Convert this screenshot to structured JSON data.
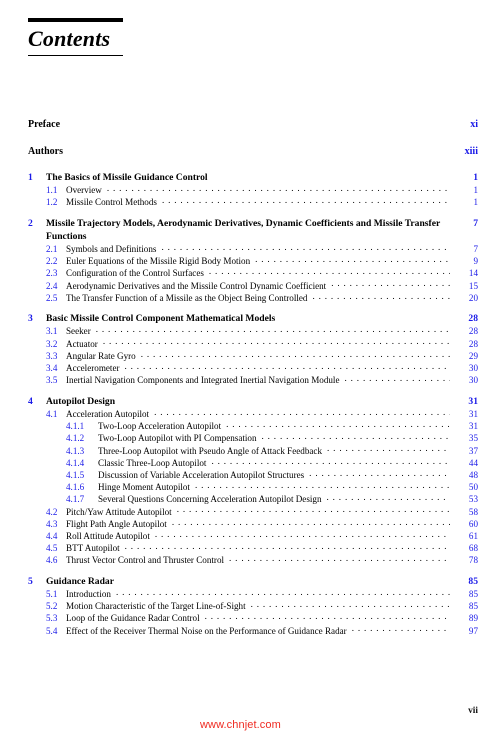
{
  "page": {
    "title": "Contents",
    "folio": "vii",
    "watermark": "www.chnjet.com",
    "accent_color": "#1a1ae8",
    "watermark_color": "#ef2b22"
  },
  "front_matter": [
    {
      "title": "Preface",
      "page": "xi"
    },
    {
      "title": "Authors",
      "page": "xiii"
    }
  ],
  "chapters": [
    {
      "num": "1",
      "title": "The Basics of Missile Guidance Control",
      "page": "1",
      "wrapped": false,
      "entries": [
        {
          "level": "section",
          "num": "1.1",
          "title": "Overview",
          "page": "1"
        },
        {
          "level": "section",
          "num": "1.2",
          "title": "Missile Control Methods",
          "page": "1"
        }
      ]
    },
    {
      "num": "2",
      "title": "Missile Trajectory Models, Aerodynamic Derivatives, Dynamic Coefficients and Missile Transfer Functions",
      "page": "7",
      "wrapped": true,
      "entries": [
        {
          "level": "section",
          "num": "2.1",
          "title": "Symbols and Definitions",
          "page": "7"
        },
        {
          "level": "section",
          "num": "2.2",
          "title": "Euler Equations of the Missile Rigid Body Motion",
          "page": "9"
        },
        {
          "level": "section",
          "num": "2.3",
          "title": "Configuration of the Control Surfaces",
          "page": "14"
        },
        {
          "level": "section",
          "num": "2.4",
          "title": "Aerodynamic Derivatives and the Missile Control Dynamic Coefficient",
          "page": "15"
        },
        {
          "level": "section",
          "num": "2.5",
          "title": "The Transfer Function of a Missile as the Object Being Controlled",
          "page": "20"
        }
      ]
    },
    {
      "num": "3",
      "title": "Basic Missile Control Component Mathematical Models",
      "page": "28",
      "wrapped": false,
      "entries": [
        {
          "level": "section",
          "num": "3.1",
          "title": "Seeker",
          "page": "28"
        },
        {
          "level": "section",
          "num": "3.2",
          "title": "Actuator",
          "page": "28"
        },
        {
          "level": "section",
          "num": "3.3",
          "title": "Angular Rate Gyro",
          "page": "29"
        },
        {
          "level": "section",
          "num": "3.4",
          "title": "Accelerometer",
          "page": "30"
        },
        {
          "level": "section",
          "num": "3.5",
          "title": "Inertial Navigation Components and Integrated Inertial Navigation Module",
          "page": "30"
        }
      ]
    },
    {
      "num": "4",
      "title": "Autopilot Design",
      "page": "31",
      "wrapped": false,
      "entries": [
        {
          "level": "section",
          "num": "4.1",
          "title": "Acceleration Autopilot",
          "page": "31"
        },
        {
          "level": "subsection",
          "num": "4.1.1",
          "title": "Two-Loop Acceleration Autopilot",
          "page": "31"
        },
        {
          "level": "subsection",
          "num": "4.1.2",
          "title": "Two-Loop Autopilot with PI Compensation",
          "page": "35"
        },
        {
          "level": "subsection",
          "num": "4.1.3",
          "title": "Three-Loop Autopilot with Pseudo Angle of Attack Feedback",
          "page": "37"
        },
        {
          "level": "subsection",
          "num": "4.1.4",
          "title": "Classic Three-Loop Autopilot",
          "page": "44"
        },
        {
          "level": "subsection",
          "num": "4.1.5",
          "title": "Discussion of Variable Acceleration Autopilot Structures",
          "page": "48"
        },
        {
          "level": "subsection",
          "num": "4.1.6",
          "title": "Hinge Moment Autopilot",
          "page": "50"
        },
        {
          "level": "subsection",
          "num": "4.1.7",
          "title": "Several Questions Concerning Acceleration Autopilot Design",
          "page": "53"
        },
        {
          "level": "section",
          "num": "4.2",
          "title": "Pitch/Yaw Attitude Autopilot",
          "page": "58"
        },
        {
          "level": "section",
          "num": "4.3",
          "title": "Flight Path Angle Autopilot",
          "page": "60"
        },
        {
          "level": "section",
          "num": "4.4",
          "title": "Roll Attitude Autopilot",
          "page": "61"
        },
        {
          "level": "section",
          "num": "4.5",
          "title": "BTT Autopilot",
          "page": "68"
        },
        {
          "level": "section",
          "num": "4.6",
          "title": "Thrust Vector Control and Thruster Control",
          "page": "78"
        }
      ]
    },
    {
      "num": "5",
      "title": "Guidance Radar",
      "page": "85",
      "wrapped": false,
      "entries": [
        {
          "level": "section",
          "num": "5.1",
          "title": "Introduction",
          "page": "85"
        },
        {
          "level": "section",
          "num": "5.2",
          "title": "Motion Characteristic of the Target Line-of-Sight",
          "page": "85"
        },
        {
          "level": "section",
          "num": "5.3",
          "title": "Loop of the Guidance Radar Control",
          "page": "89"
        },
        {
          "level": "section",
          "num": "5.4",
          "title": "Effect of the Receiver Thermal Noise on the Performance of Guidance Radar",
          "page": "97"
        }
      ]
    }
  ]
}
